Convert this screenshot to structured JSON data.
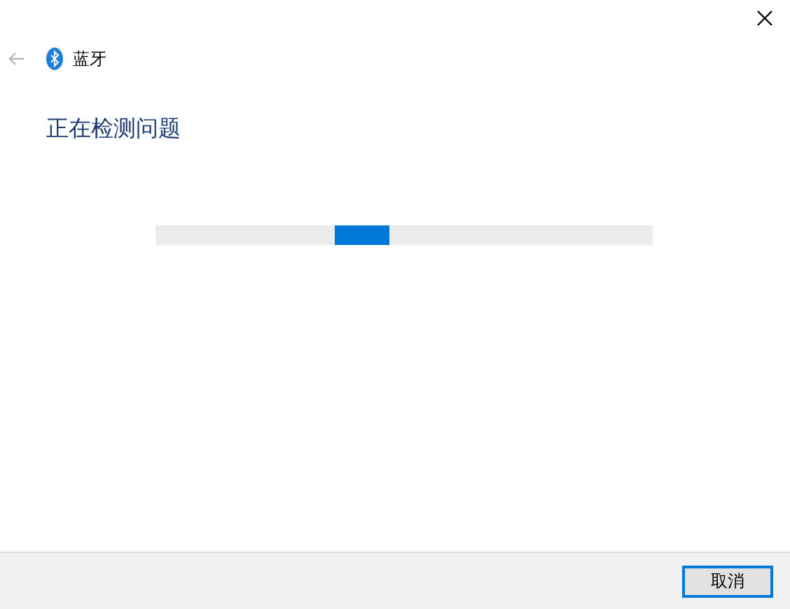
{
  "header": {
    "back_disabled": true,
    "title": "蓝牙"
  },
  "heading": "正在检测问题",
  "progress": {
    "indeterminate": true
  },
  "buttons": [
    {
      "label": "取消",
      "focused": true
    }
  ]
}
